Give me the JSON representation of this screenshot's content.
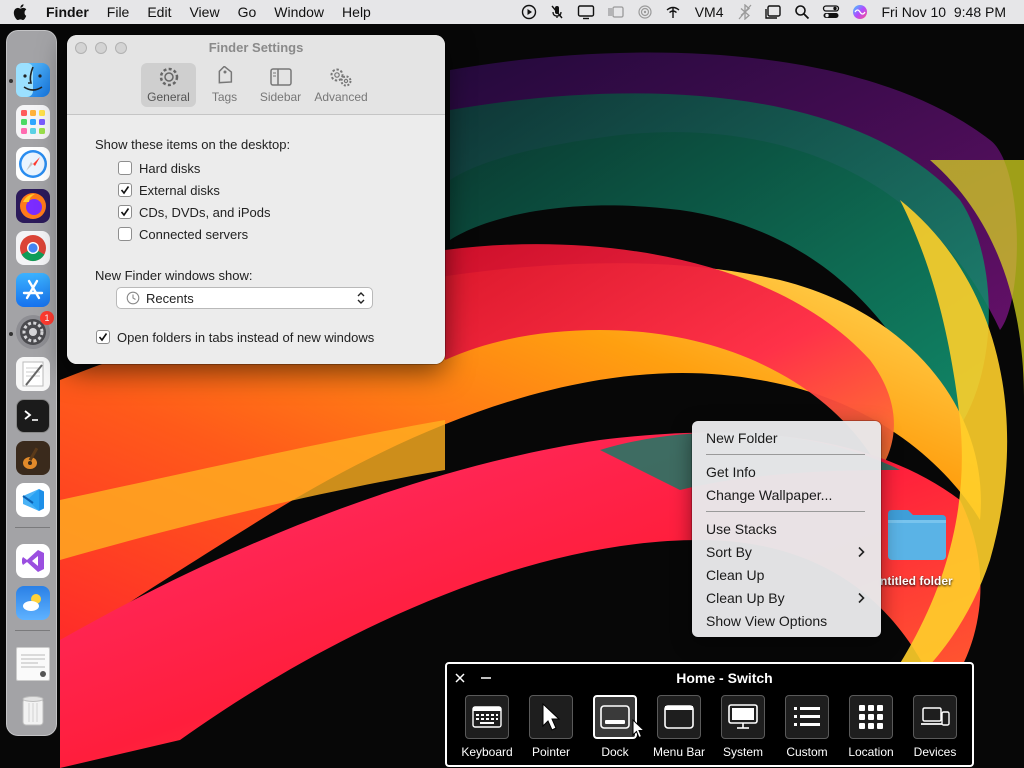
{
  "menubar": {
    "apple_icon": "apple-logo-icon",
    "app_name": "Finder",
    "menus": [
      "File",
      "Edit",
      "View",
      "Go",
      "Window",
      "Help"
    ],
    "status_items": [
      {
        "name": "play-circle-icon"
      },
      {
        "name": "mic-muted-icon"
      },
      {
        "name": "display-icon"
      },
      {
        "name": "stage-manager-icon"
      },
      {
        "name": "airplay-icon"
      },
      {
        "name": "network-icon"
      },
      {
        "name": "vm-label",
        "text": "VM4"
      },
      {
        "name": "bluetooth-off-icon"
      },
      {
        "name": "window-icon"
      },
      {
        "name": "spotlight-search-icon"
      },
      {
        "name": "control-center-icon"
      },
      {
        "name": "siri-icon"
      }
    ],
    "clock": "Fri Nov 10  9:48 PM"
  },
  "dock": {
    "items": [
      {
        "name": "finder",
        "icon": "finder-icon",
        "running": true
      },
      {
        "name": "launchpad",
        "icon": "launchpad-icon"
      },
      {
        "name": "safari",
        "icon": "safari-icon"
      },
      {
        "name": "firefox",
        "icon": "firefox-icon"
      },
      {
        "name": "chrome",
        "icon": "chrome-icon"
      },
      {
        "name": "app-store",
        "icon": "app-store-icon"
      },
      {
        "name": "system-settings",
        "icon": "system-settings-icon",
        "badge": "1",
        "running": true
      },
      {
        "name": "textedit",
        "icon": "textedit-icon"
      },
      {
        "name": "terminal",
        "icon": "terminal-icon"
      },
      {
        "name": "garageband",
        "icon": "garageband-icon"
      },
      {
        "name": "vscode",
        "icon": "vscode-icon"
      },
      {
        "name": "visual-studio",
        "icon": "visual-studio-icon"
      },
      {
        "name": "weather",
        "icon": "weather-icon"
      },
      {
        "name": "document-preview",
        "icon": "document-preview-icon"
      },
      {
        "name": "trash",
        "icon": "trash-icon"
      }
    ]
  },
  "finder_settings": {
    "title": "Finder Settings",
    "tabs": [
      {
        "label": "General",
        "icon": "gear-icon",
        "active": true
      },
      {
        "label": "Tags",
        "icon": "tag-icon"
      },
      {
        "label": "Sidebar",
        "icon": "sidebar-icon"
      },
      {
        "label": "Advanced",
        "icon": "gears-icon"
      }
    ],
    "desktop_heading": "Show these items on the desktop:",
    "desktop_items": [
      {
        "label": "Hard disks",
        "checked": false
      },
      {
        "label": "External disks",
        "checked": true
      },
      {
        "label": "CDs, DVDs, and iPods",
        "checked": true
      },
      {
        "label": "Connected servers",
        "checked": false
      }
    ],
    "new_windows_label": "New Finder windows show:",
    "new_windows_value": "Recents",
    "new_windows_icon": "clock-icon",
    "open_in_tabs": {
      "label": "Open folders in tabs instead of new windows",
      "checked": true
    }
  },
  "context_menu": {
    "items": [
      "New Folder",
      "Get Info",
      "Change Wallpaper...",
      "Use Stacks",
      "Sort By",
      "Clean Up",
      "Clean Up By",
      "Show View Options"
    ],
    "submenu_items": [
      "Sort By",
      "Clean Up By"
    ]
  },
  "desktop_folder": {
    "label": "ntitled folder",
    "color": "#5ab3e6"
  },
  "switch_panel": {
    "title": "Home - Switch",
    "close_icon": "close-icon",
    "minimize_icon": "minimize-icon",
    "buttons": [
      {
        "label": "Keyboard",
        "icon": "keyboard-icon"
      },
      {
        "label": "Pointer",
        "icon": "pointer-icon"
      },
      {
        "label": "Dock",
        "icon": "dock-icon",
        "active": true
      },
      {
        "label": "Menu Bar",
        "icon": "menu-bar-icon"
      },
      {
        "label": "System",
        "icon": "system-icon"
      },
      {
        "label": "Custom",
        "icon": "custom-list-icon"
      },
      {
        "label": "Location",
        "icon": "location-grid-icon"
      },
      {
        "label": "Devices",
        "icon": "devices-icon"
      }
    ]
  },
  "colors": {
    "menubar_bg": "#e6e6e8",
    "accent_blue": "#1e8fe8",
    "switch_bg": "#000000",
    "badge_red": "#ff3b30"
  }
}
